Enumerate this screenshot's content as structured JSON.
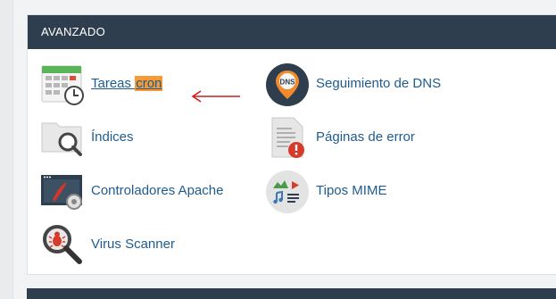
{
  "section": {
    "title": "AVANZADO"
  },
  "items": [
    {
      "label_main": "Tareas ",
      "label_highlight": "cron",
      "icon": "calendar-clock-icon"
    },
    {
      "label": "Seguimiento de DNS",
      "icon": "dns-pin-icon",
      "icon_text": "DNS"
    },
    {
      "label": "Índices",
      "icon": "folder-search-icon"
    },
    {
      "label": "Páginas de error",
      "icon": "error-page-icon"
    },
    {
      "label": "Controladores Apache",
      "icon": "apache-handler-icon"
    },
    {
      "label": "Tipos MIME",
      "icon": "mime-types-icon"
    },
    {
      "label": "Virus Scanner",
      "icon": "virus-scanner-icon"
    }
  ],
  "colors": {
    "header_bg": "#2e3e4e",
    "link": "#1f5c8e",
    "highlight": "#f59a36",
    "arrow": "#cc1f1f"
  }
}
